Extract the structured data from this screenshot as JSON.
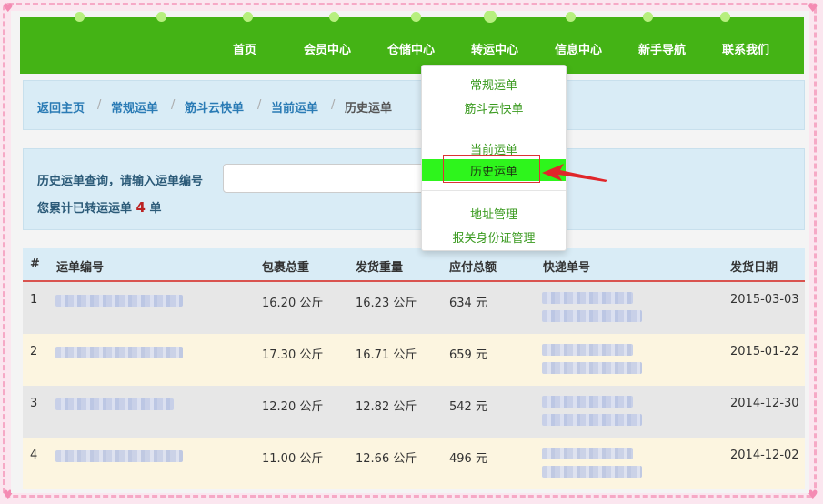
{
  "nav": {
    "items": [
      "首页",
      "会员中心",
      "仓储中心",
      "转运中心",
      "信息中心",
      "新手导航",
      "联系我们"
    ]
  },
  "breadcrumb": {
    "items": [
      "返回主页",
      "常规运单",
      "筋斗云快单",
      "当前运单"
    ],
    "current": "历史运单",
    "separator": "/"
  },
  "query": {
    "label": "历史运单查询，请输入运单编号",
    "input_value": "",
    "total_prefix": "您累计已转运运单",
    "total_count": "4",
    "total_suffix": "单"
  },
  "table": {
    "headers": [
      "#",
      "运单编号",
      "包裹总重",
      "发货重量",
      "应付总额",
      "快递单号",
      "发货日期"
    ],
    "rows": [
      {
        "index": "1",
        "weight": "16.20 公斤",
        "ship_weight": "16.23 公斤",
        "amount": "634 元",
        "date": "2015-03-03"
      },
      {
        "index": "2",
        "weight": "17.30 公斤",
        "ship_weight": "16.71 公斤",
        "amount": "659 元",
        "date": "2015-01-22"
      },
      {
        "index": "3",
        "weight": "12.20 公斤",
        "ship_weight": "12.82 公斤",
        "amount": "542 元",
        "date": "2014-12-30"
      },
      {
        "index": "4",
        "weight": "11.00 公斤",
        "ship_weight": "12.66 公斤",
        "amount": "496 元",
        "date": "2014-12-02"
      }
    ]
  },
  "dropdown": {
    "group1": [
      "常规运单",
      "筋斗云快单"
    ],
    "group2_before": "当前运单",
    "active": "历史运单",
    "group3": [
      "地址管理",
      "报关身份证管理"
    ]
  },
  "colors": {
    "nav_bg": "#44b315",
    "active_item": "#2ef51c",
    "accent_red": "#d33",
    "link_blue": "#2a7bb5",
    "panel_bg": "#d9ecf6"
  }
}
